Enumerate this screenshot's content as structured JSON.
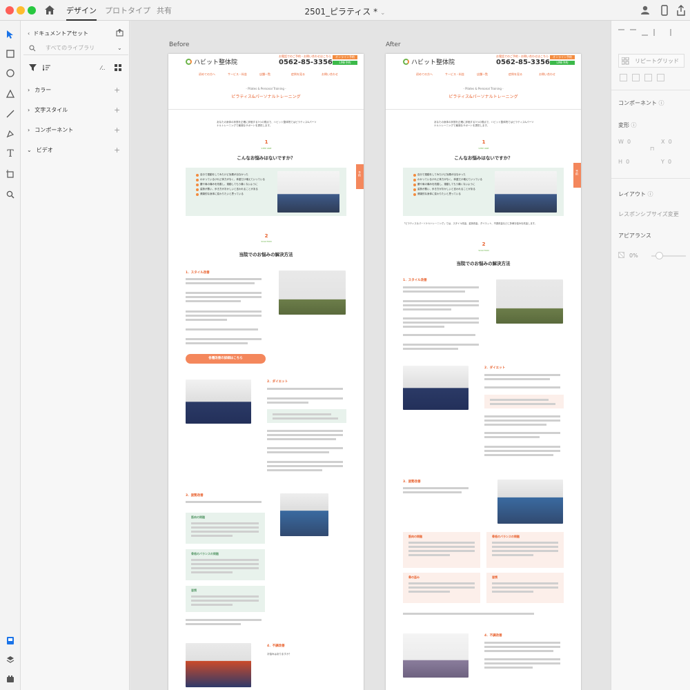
{
  "titlebar": {
    "tabs": [
      "デザイン",
      "プロトタイプ",
      "共有"
    ],
    "active_tab": "デザイン",
    "doc_title": "2501_ピラティス *"
  },
  "left_panel": {
    "doc_assets": "ドキュメントアセット",
    "search_placeholder": "すべてのライブラリ",
    "sections": [
      "カラー",
      "文字スタイル",
      "コンポーネント",
      "ビデオ"
    ]
  },
  "right_panel": {
    "repeat_grid": "リピートグリッド",
    "component": "コンポーネント",
    "transform": "変形",
    "w_label": "W",
    "w_val": "0",
    "h_label": "H",
    "h_val": "0",
    "x_label": "X",
    "x_val": "0",
    "y_label": "Y",
    "y_val": "0",
    "layout": "レイアウト",
    "responsive": "レスポンシブサイズ変更",
    "appearance": "アピアランス",
    "opacity": "0%"
  },
  "artboards": {
    "before_label": "Before",
    "after_label": "After"
  },
  "site": {
    "logo": "ハビット整体院",
    "phone": "0562-85-3356",
    "phone_note": "お電話でのご予約・お問い合わせはこちら",
    "online_btn": "オンライン予約",
    "line_btn": "LINE予約",
    "nav": [
      "初めての方へ",
      "サービス・料金",
      "店舗一覧",
      "症例を見る",
      "お問い合わせ"
    ],
    "page_sub": "- Pilates & Personal Training -",
    "page_title": "ピラティス&パーソナルトレーニング",
    "intro": "あなたの身体の状態を正確に評価する3つの視点で、ハビット整体院ではピラティス&パーソナルトレーニングで最適なサポートを提供します。",
    "badge1": "1",
    "badge1_sub": "STEP ONE",
    "worry_title": "こんなお悩みはないですか？",
    "worries": [
      "自分で運動をしてみたけど効果が出なかった",
      "わかっているけれど体力がなく、体重だけ増えていっている",
      "腰や肩の痛みを改善し、運動してもう痛くないように",
      "姿勢が悪い、歩き方がおかしいと言われることがある",
      "健康的な身体に変わりたいと思っている"
    ],
    "after_note": "「ピラティス＆パーソナルトレーニング」では、スタイル改善、姿勢改善、ダイエット、不調改善などに多様な悩みを改善します。",
    "badge2": "2",
    "badge2_sub": "SOLUTION",
    "solution_title": "当院でのお悩みの解決方法",
    "s1_title": "1．スタイル改善",
    "cta": "各種改善の詳細はこちら",
    "s2_title": "2．ダイエット",
    "s2_box": "「ダイエットは運動を頑張らないといけない」お悩みは運動をしなくても改善できます",
    "s3_title": "3．姿勢改善",
    "s3_boxes": [
      "筋肉の問題",
      "骨格のバランスの問題",
      "骨の歪み",
      "習慣"
    ],
    "s4_title": "4．不調改善",
    "s4_text": "お悩みはありますか？"
  }
}
